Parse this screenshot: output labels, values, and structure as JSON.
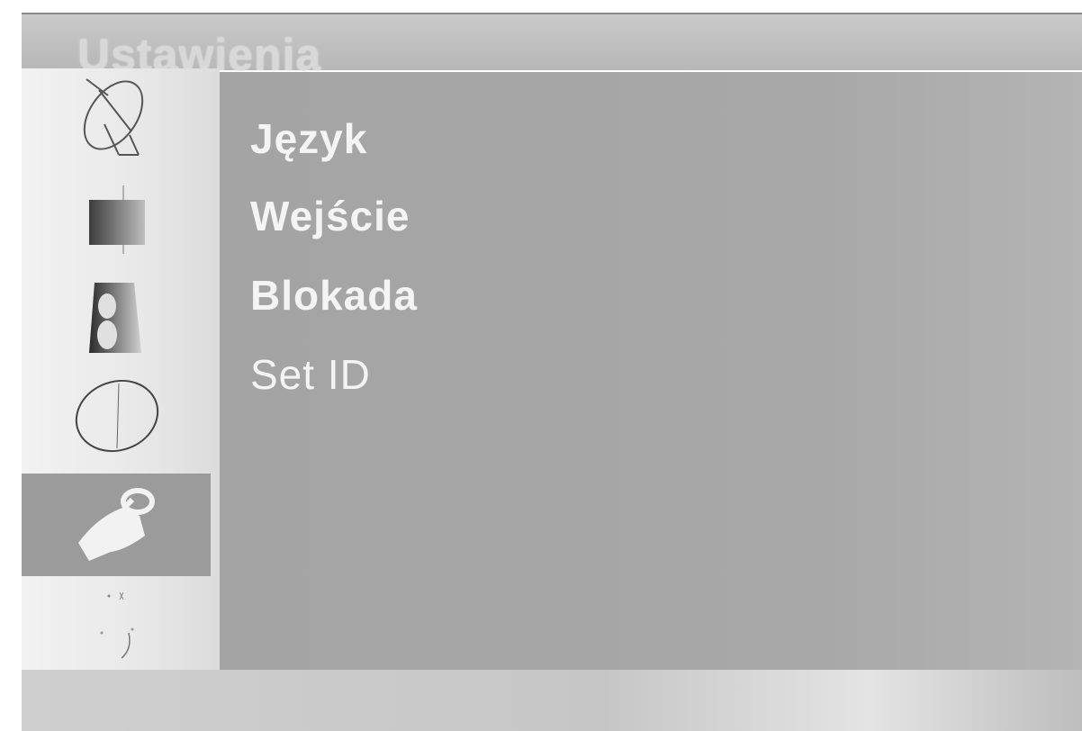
{
  "header": {
    "title": "Ustawienia"
  },
  "sidebar": {
    "items": [
      {
        "icon": "satellite-dish-icon"
      },
      {
        "icon": "picture-icon"
      },
      {
        "icon": "sound-icon"
      },
      {
        "icon": "time-icon"
      },
      {
        "icon": "setup-key-icon",
        "selected": true
      },
      {
        "icon": "small-glyph-icon"
      },
      {
        "icon": "partial-circle-icon"
      }
    ]
  },
  "menu": {
    "items": [
      {
        "label": "Język"
      },
      {
        "label": "Wejście"
      },
      {
        "label": "Blokada"
      },
      {
        "label": "Set ID"
      }
    ]
  },
  "colors": {
    "selected_bg": "#9b9b9b",
    "panel_bg": "#a6a6a6",
    "menu_text": "#f4f4f4"
  }
}
